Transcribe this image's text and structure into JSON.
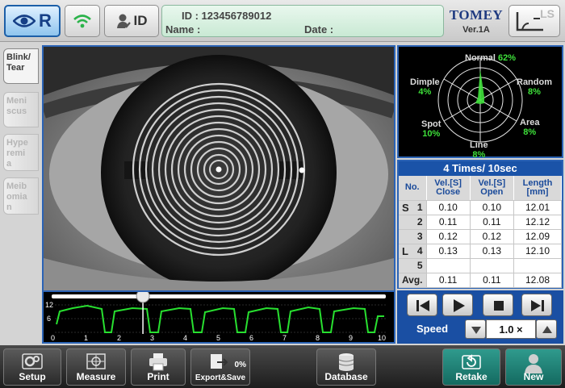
{
  "header": {
    "eye_side": "R",
    "id_label": "ID",
    "patient_id": "ID : 123456789012",
    "patient_name": "Name :",
    "patient_date": "Date :",
    "logo": "TOMEY",
    "version": "Ver.1A",
    "ls_label": "LS"
  },
  "tabs": [
    {
      "label": "Blink/\nTear",
      "active": true
    },
    {
      "label": "Meni\nscus",
      "active": false
    },
    {
      "label": "Hype\nremi\na",
      "active": false
    },
    {
      "label": "Meib\nomia\nn",
      "active": false
    }
  ],
  "radar": {
    "labels": [
      {
        "name": "Normal",
        "pct": "62%"
      },
      {
        "name": "Random",
        "pct": "8%"
      },
      {
        "name": "Area",
        "pct": "8%"
      },
      {
        "name": "Line",
        "pct": "8%"
      },
      {
        "name": "Spot",
        "pct": "10%"
      },
      {
        "name": "Dimple",
        "pct": "4%"
      }
    ]
  },
  "table": {
    "title": "4 Times/ 10sec",
    "headers": [
      "No.",
      "Vel.[S]\nClose",
      "Vel.[S]\nOpen",
      "Length\n[mm]"
    ],
    "rows": [
      {
        "side": "S",
        "no": "1",
        "close": "0.10",
        "open": "0.10",
        "length": "12.01"
      },
      {
        "side": "",
        "no": "2",
        "close": "0.11",
        "open": "0.11",
        "length": "12.12"
      },
      {
        "side": "",
        "no": "3",
        "close": "0.12",
        "open": "0.12",
        "length": "12.09"
      },
      {
        "side": "L",
        "no": "4",
        "close": "0.13",
        "open": "0.13",
        "length": "12.10"
      },
      {
        "side": "",
        "no": "5",
        "close": "",
        "open": "",
        "length": ""
      },
      {
        "side": "",
        "no": "Avg.",
        "close": "0.11",
        "open": "0.11",
        "length": "12.08"
      }
    ]
  },
  "timeline": {
    "y_ticks": [
      "12",
      "6",
      "0"
    ],
    "x_ticks": [
      "0",
      "1",
      "2",
      "3",
      "4",
      "5",
      "6",
      "7",
      "8",
      "9",
      "10"
    ],
    "position_seconds": 2.7,
    "max_seconds": 10
  },
  "controls": {
    "speed_label": "Speed",
    "speed_value": "1.0 ×"
  },
  "toolbar": {
    "setup": "Setup",
    "measure": "Measure",
    "print": "Print",
    "export": "Export&Save",
    "export_badge": "0%",
    "database": "Database",
    "retake": "Retake",
    "new": "New"
  }
}
